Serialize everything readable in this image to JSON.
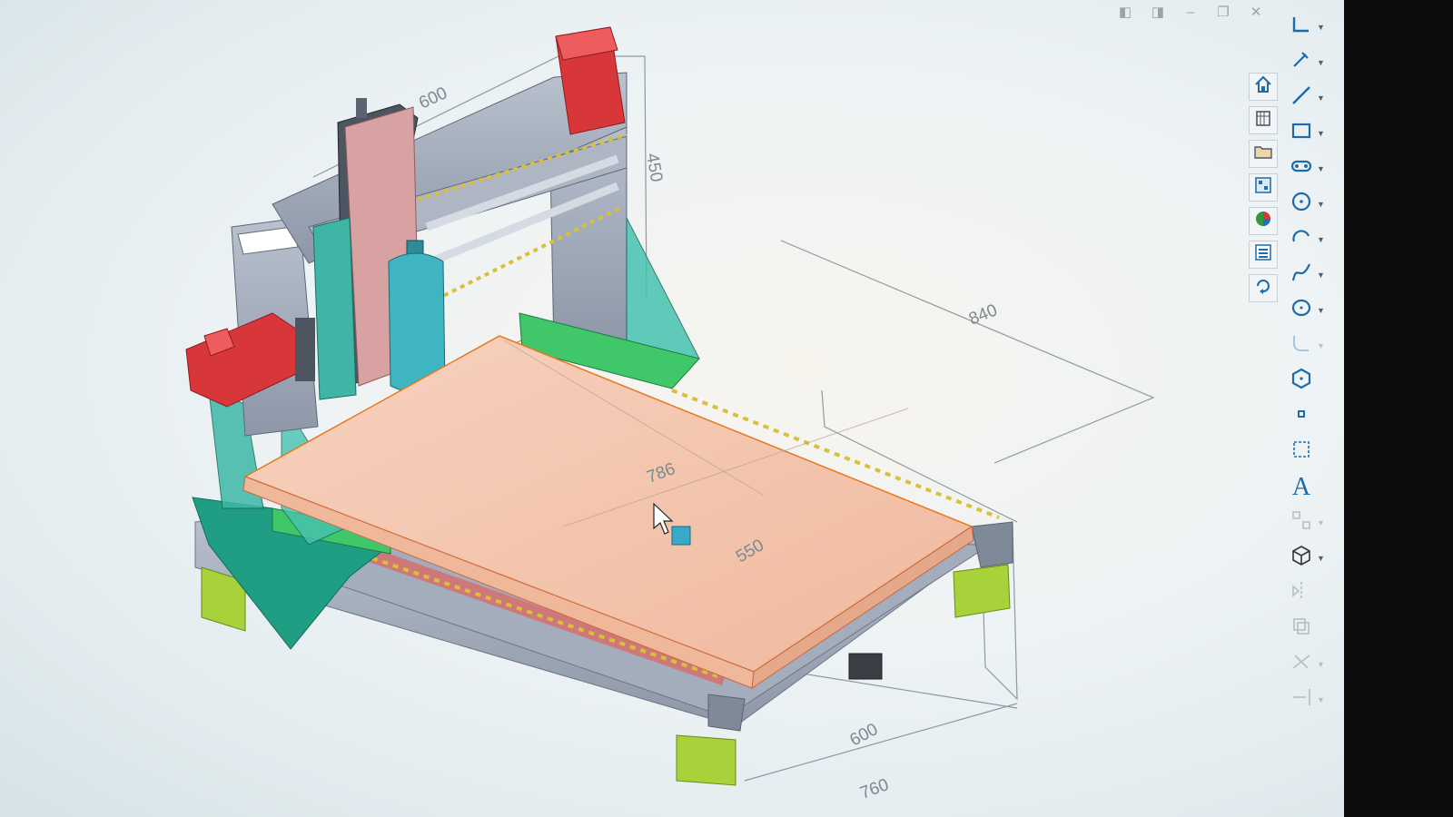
{
  "window": {
    "controls": [
      {
        "name": "pane-left-button",
        "icon": "pane-left-icon",
        "glyph": "◧"
      },
      {
        "name": "pane-right-button",
        "icon": "pane-right-icon",
        "glyph": "◨"
      },
      {
        "name": "minimize-button",
        "icon": "minimize-icon",
        "glyph": "–"
      },
      {
        "name": "restore-button",
        "icon": "restore-icon",
        "glyph": "❐"
      },
      {
        "name": "close-button",
        "icon": "close-icon",
        "glyph": "✕"
      }
    ]
  },
  "side_panel": {
    "items": [
      {
        "name": "home",
        "icon": "home-icon"
      },
      {
        "name": "parts",
        "icon": "parts-library-icon"
      },
      {
        "name": "open",
        "icon": "folder-icon"
      },
      {
        "name": "tree",
        "icon": "assembly-tree-icon"
      },
      {
        "name": "appearance",
        "icon": "appearance-icon"
      },
      {
        "name": "properties",
        "icon": "properties-list-icon"
      },
      {
        "name": "rebuild",
        "icon": "rebuild-icon"
      }
    ]
  },
  "toolbar": {
    "items": [
      {
        "name": "smart-line",
        "icon": "smart-line-icon",
        "dropdown": true
      },
      {
        "name": "sketch-edit",
        "icon": "sketch-edit-icon",
        "dropdown": true
      },
      {
        "name": "line",
        "icon": "line-icon",
        "dropdown": true
      },
      {
        "name": "rectangle",
        "icon": "rectangle-icon",
        "dropdown": true
      },
      {
        "name": "slot",
        "icon": "slot-icon",
        "dropdown": true
      },
      {
        "name": "circle",
        "icon": "circle-icon",
        "dropdown": true
      },
      {
        "name": "arc",
        "icon": "arc-icon",
        "dropdown": true
      },
      {
        "name": "spline",
        "icon": "spline-icon",
        "dropdown": true
      },
      {
        "name": "ellipse",
        "icon": "ellipse-icon",
        "dropdown": true
      },
      {
        "name": "fillet",
        "icon": "fillet-icon",
        "dropdown": true,
        "faded": true
      },
      {
        "name": "polygon",
        "icon": "polygon-icon",
        "dropdown": false
      },
      {
        "name": "point",
        "icon": "point-icon",
        "dropdown": false
      },
      {
        "name": "construction",
        "icon": "construction-geometry-icon",
        "dropdown": false
      },
      {
        "name": "text",
        "icon": "text-icon",
        "dropdown": false,
        "glyph": "A"
      },
      {
        "name": "pattern",
        "icon": "pattern-icon",
        "dropdown": true,
        "faded": true
      },
      {
        "name": "view-cube",
        "icon": "view-cube-icon",
        "dropdown": true
      },
      {
        "name": "mirror",
        "icon": "mirror-icon",
        "dropdown": false,
        "faded": true
      },
      {
        "name": "offset",
        "icon": "offset-icon",
        "dropdown": false,
        "faded": true
      },
      {
        "name": "trim",
        "icon": "trim-icon",
        "dropdown": true,
        "faded": true
      },
      {
        "name": "extend",
        "icon": "extend-icon",
        "dropdown": true,
        "faded": true
      }
    ]
  },
  "model": {
    "dimensions": [
      {
        "name": "gantry-width",
        "value": "600"
      },
      {
        "name": "gantry-height",
        "value": "450"
      },
      {
        "name": "travel-length",
        "value": "840"
      },
      {
        "name": "bed-diagonal",
        "value": "786"
      },
      {
        "name": "bed-width",
        "value": "550"
      },
      {
        "name": "frame-width",
        "value": "600"
      },
      {
        "name": "frame-length",
        "value": "760"
      }
    ]
  },
  "colors": {
    "frame": "#9fa8b8",
    "bed": "#f4c6ad",
    "motor": "#d8373a",
    "spindle": "#3fb5c2",
    "bracket": "#1f9e84",
    "base-plate": "#3fc76a",
    "foot": "#a7d23a",
    "carriage": "#d8a2a2",
    "dimension": "#8c9aa2",
    "icon": "#1f6aa8",
    "accent": "#e6781e"
  }
}
